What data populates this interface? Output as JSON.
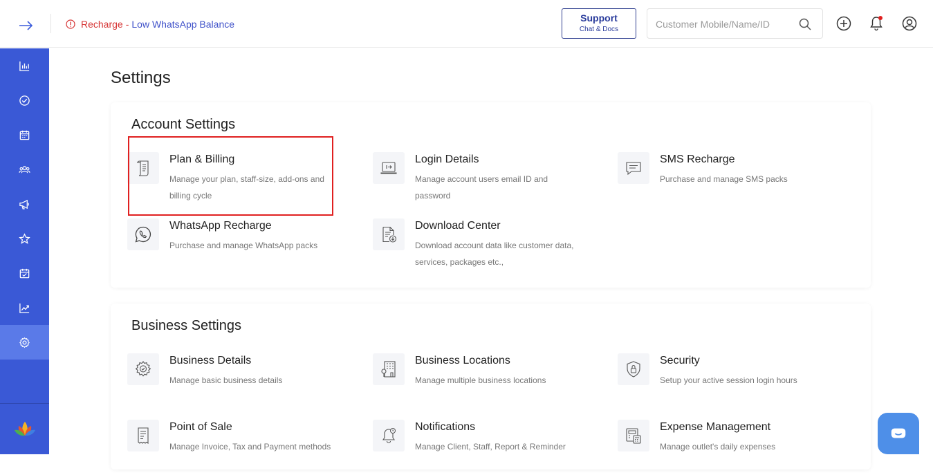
{
  "alert": {
    "recharge": "Recharge",
    "separator": "-",
    "low_balance": "Low WhatsApp Balance"
  },
  "support": {
    "title": "Support",
    "subtitle": "Chat & Docs"
  },
  "search": {
    "placeholder": "Customer Mobile/Name/ID",
    "value": ""
  },
  "sidebar": {
    "items": [
      {
        "icon": "bar-chart-icon"
      },
      {
        "icon": "check-circle-icon"
      },
      {
        "icon": "calendar-icon"
      },
      {
        "icon": "users-icon"
      },
      {
        "icon": "megaphone-icon"
      },
      {
        "icon": "star-icon"
      },
      {
        "icon": "calendar-check-icon"
      },
      {
        "icon": "trend-icon"
      },
      {
        "icon": "gear-icon",
        "active": true
      }
    ]
  },
  "page": {
    "title": "Settings"
  },
  "account": {
    "title": "Account Settings",
    "items": [
      {
        "icon": "scroll-icon",
        "title": "Plan & Billing",
        "desc": "Manage your plan, staff-size, add-ons and billing cycle"
      },
      {
        "icon": "laptop-login-icon",
        "title": "Login Details",
        "desc": "Manage account users email ID and password"
      },
      {
        "icon": "message-icon",
        "title": "SMS Recharge",
        "desc": "Purchase and manage SMS packs"
      },
      {
        "icon": "whatsapp-icon",
        "title": "WhatsApp Recharge",
        "desc": "Purchase and manage WhatsApp packs"
      },
      {
        "icon": "download-doc-icon",
        "title": "Download Center",
        "desc": "Download account data like customer data, services, packages etc.,"
      }
    ]
  },
  "business": {
    "title": "Business Settings",
    "items": [
      {
        "icon": "gear-badge-icon",
        "title": "Business Details",
        "desc": "Manage basic business details"
      },
      {
        "icon": "building-icon",
        "title": "Business Locations",
        "desc": "Manage multiple business locations"
      },
      {
        "icon": "shield-lock-icon",
        "title": "Security",
        "desc": "Setup your active session login hours"
      },
      {
        "icon": "receipt-icon",
        "title": "Point of Sale",
        "desc": "Manage Invoice, Tax and Payment methods"
      },
      {
        "icon": "bell-clock-icon",
        "title": "Notifications",
        "desc": "Manage Client, Staff, Report & Reminder"
      },
      {
        "icon": "calculator-icon",
        "title": "Expense Management",
        "desc": "Manage outlet's daily expenses"
      }
    ]
  },
  "colors": {
    "sidebar": "#3a59d6",
    "sidebar_active": "#5a7ae8",
    "alert": "#d63333",
    "link": "#3f51c9",
    "highlight": "#e02020",
    "chat": "#4e8fe8"
  }
}
